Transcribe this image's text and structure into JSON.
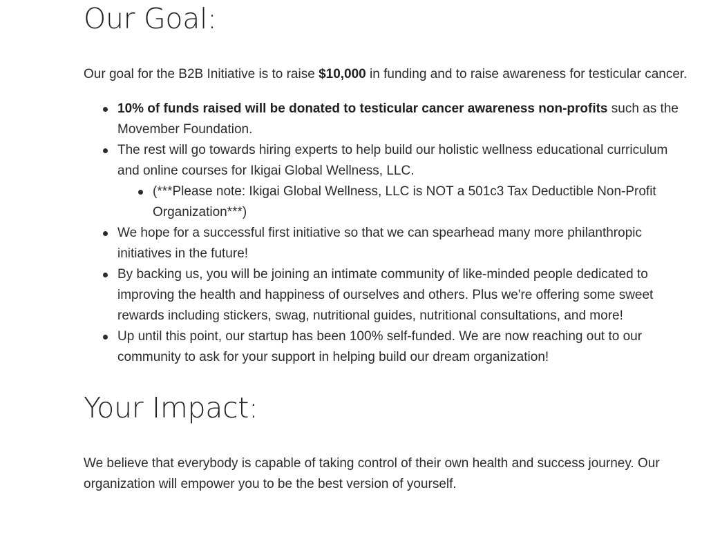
{
  "goal": {
    "heading": "Our Goal:",
    "intro_before": "Our goal for the B2B Initiative is to raise ",
    "intro_amount": "$10,000",
    "intro_after": " in funding and to raise awareness for testicular cancer.",
    "bullets": {
      "donation_bold": "10% of funds raised will be donated to testicular cancer awareness non-profits",
      "donation_rest": " such as the Movember Foundation.",
      "hiring": "The rest will go towards hiring experts to help build our holistic wellness educational curriculum and online courses for Ikigai Global Wellness, LLC.",
      "note": "(***Please note: Ikigai Global Wellness, LLC is NOT a 501c3 Tax Deductible Non-Profit Organization***)",
      "initiative": "We hope for a successful first initiative so that we can spearhead many more philanthropic initiatives in the future!",
      "community": "By backing us, you will be joining an intimate community of like-minded people dedicated to improving the health and happiness of ourselves and others. Plus we're offering some sweet rewards including stickers, swag, nutritional guides, nutritional consultations, and more!",
      "selffunded": "Up until this point, our startup has been 100% self-funded. We are now reaching out to our community to ask for your support in helping build our dream organization!"
    }
  },
  "impact": {
    "heading": "Your Impact:",
    "text": "We believe that everybody is capable of taking control of their own health and success journey. Our organization will empower you to be the best version of yourself."
  }
}
